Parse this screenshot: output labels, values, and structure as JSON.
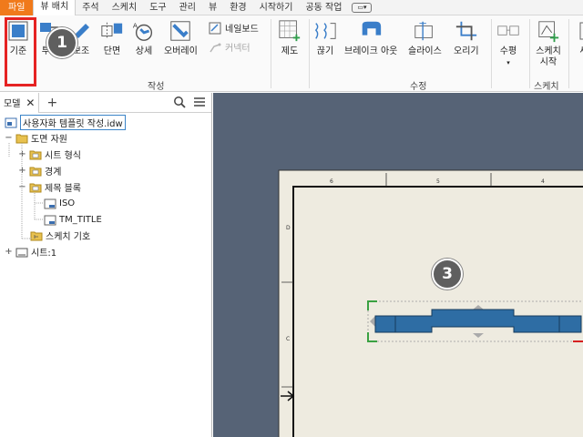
{
  "menu": {
    "tabs": [
      {
        "label": "파일"
      },
      {
        "label": "뷰 배치"
      },
      {
        "label": "주석"
      },
      {
        "label": "스케치"
      },
      {
        "label": "도구"
      },
      {
        "label": "관리"
      },
      {
        "label": "뷰"
      },
      {
        "label": "환경"
      },
      {
        "label": "시작하기"
      },
      {
        "label": "공동 작업"
      }
    ],
    "active_tab": "뷰 배치"
  },
  "ribbon": {
    "buttons": {
      "base": "기준",
      "projected": "투영",
      "auxiliary": "보조",
      "section": "단면",
      "detail": "상세",
      "overlay": "오버레이",
      "nailboard": "네일보드",
      "connector": "커넥터",
      "draft": "제도",
      "break": "끊기",
      "break_out": "브레이크 아웃",
      "slice": "슬라이스",
      "crop": "오리기",
      "horizontal": "수평",
      "start_sketch": "스케치 시작",
      "new": "새"
    },
    "groups": {
      "create": "작성",
      "modify": "수정",
      "sketch": "스케치"
    }
  },
  "badges": {
    "first": "1",
    "third": "3"
  },
  "browser": {
    "tab_label": "모델",
    "tree": [
      {
        "label": "사용자화 템플릿 작성.idw",
        "level": 0,
        "toggle": ""
      },
      {
        "label": "도면 자원",
        "level": 0,
        "toggle": "−"
      },
      {
        "label": "시트 형식",
        "level": 1,
        "toggle": "+"
      },
      {
        "label": "경계",
        "level": 1,
        "toggle": "+"
      },
      {
        "label": "제목 블록",
        "level": 1,
        "toggle": "−"
      },
      {
        "label": "ISO",
        "level": 2,
        "toggle": ""
      },
      {
        "label": "TM_TITLE",
        "level": 2,
        "toggle": ""
      },
      {
        "label": "스케치 기호",
        "level": 1,
        "toggle": ""
      },
      {
        "label": "시트:1",
        "level": 0,
        "toggle": "+"
      }
    ]
  },
  "drawing": {
    "top_zones": [
      "6",
      "5",
      "4"
    ],
    "side_zones": [
      "D",
      "C"
    ]
  },
  "colors": {
    "file_tab": "#f07a1b",
    "highlight": "#e52222",
    "canvas_bg": "#566376",
    "sheet_bg": "#eeebe0",
    "part_fill": "#2e6da4"
  }
}
